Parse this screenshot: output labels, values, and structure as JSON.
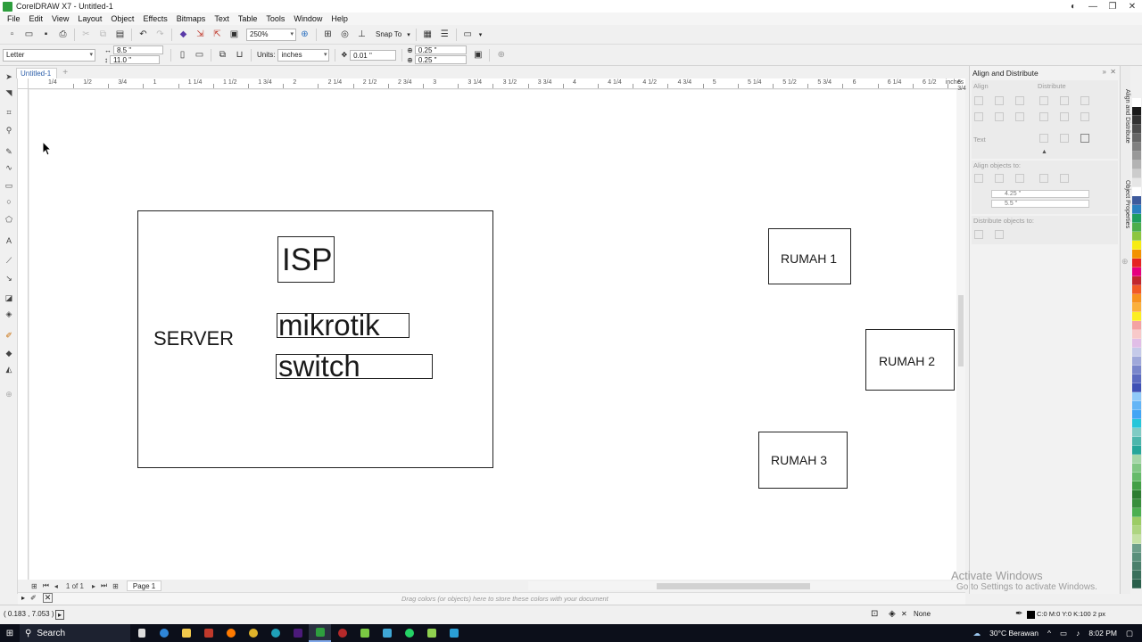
{
  "window": {
    "title": "CorelDRAW X7 - Untitled-1"
  },
  "menu": [
    "File",
    "Edit",
    "View",
    "Layout",
    "Object",
    "Effects",
    "Bitmaps",
    "Text",
    "Table",
    "Tools",
    "Window",
    "Help"
  ],
  "toolbar": {
    "zoom": "250%",
    "snap_to": "Snap To"
  },
  "property_bar": {
    "page_size": "Letter",
    "width": "8.5 \"",
    "height": "11.0 \"",
    "units_label": "Units:",
    "units_value": "inches",
    "nudge": "0.01 \"",
    "dup_x": "0.25 \"",
    "dup_y": "0.25 \""
  },
  "document_tab": "Untitled-1",
  "ruler": {
    "labels": [
      "1/4",
      "1/2",
      "3/4",
      "1",
      "1 1/4",
      "1 1/2",
      "1 3/4",
      "2",
      "2 1/4",
      "2 1/2",
      "2 3/4",
      "3",
      "3 1/4",
      "3 1/2",
      "3 3/4",
      "4",
      "4 1/4",
      "4 1/2",
      "4 3/4",
      "5",
      "5 1/4",
      "5 1/2",
      "5 3/4",
      "6",
      "6 1/4",
      "6 1/2",
      "6 3/4"
    ],
    "units": "inches"
  },
  "canvas": {
    "server_label": "SERVER",
    "isp_label": "ISP",
    "mikrotik_label": "mikrotik",
    "switch_label": "switch",
    "rumah1_label": "RUMAH 1",
    "rumah2_label": "RUMAH 2",
    "rumah3_label": "RUMAH 3"
  },
  "page_nav": {
    "count": "1 of 1",
    "page_tab": "Page 1"
  },
  "palette_hint": "Drag colors (or objects) here to store these colors with your document",
  "docker": {
    "title": "Align and Distribute",
    "align_label": "Align",
    "distribute_label": "Distribute",
    "text_label": "Text",
    "align_objects_to": "Align objects to:",
    "x_value": "4.25 \"",
    "y_value": "5.5 \"",
    "distribute_objects_to": "Distribute objects to:"
  },
  "vertical_tabs": [
    "Align and Distribute",
    "Object Properties"
  ],
  "palette_colors": [
    "#ffffff",
    "#1a1a1a",
    "#333333",
    "#4d4d4d",
    "#666666",
    "#808080",
    "#999999",
    "#b3b3b3",
    "#cccccc",
    "#e6e6e6",
    "#ffffff",
    "#3d5a9c",
    "#2a7fbf",
    "#1f9e5e",
    "#4cae4c",
    "#8cc63f",
    "#f7ec13",
    "#f39200",
    "#e52421",
    "#e6007e",
    "#c1272d",
    "#f15a24",
    "#f7931e",
    "#fbb03b",
    "#fcee21",
    "#f4a3a3",
    "#f8c9c9",
    "#e1bee7",
    "#c5cae9",
    "#9fa8da",
    "#7986cb",
    "#5c6bc0",
    "#3f51b5",
    "#90caf9",
    "#64b5f6",
    "#42a5f5",
    "#26c6da",
    "#80cbc4",
    "#4db6ac",
    "#26a69a",
    "#a5d6a7",
    "#81c784",
    "#66bb6a",
    "#43a047",
    "#2e7d32",
    "#388e3c",
    "#4caf50",
    "#9ccc65",
    "#aed581",
    "#c5e1a5",
    "#6d9e8a",
    "#5a8f7b",
    "#4a7f6b",
    "#3a6f5b",
    "#2a5f4b"
  ],
  "status": {
    "coords": "( 0.183 , 7.053 )",
    "fill": "None",
    "outline": "C:0 M:0 Y:0 K:100  2 px"
  },
  "watermark": {
    "line1": "Activate Windows",
    "line2": "Go to Settings to activate Windows."
  },
  "taskbar": {
    "search": "Search",
    "weather": "30°C  Berawan",
    "time": "8:02 PM"
  }
}
